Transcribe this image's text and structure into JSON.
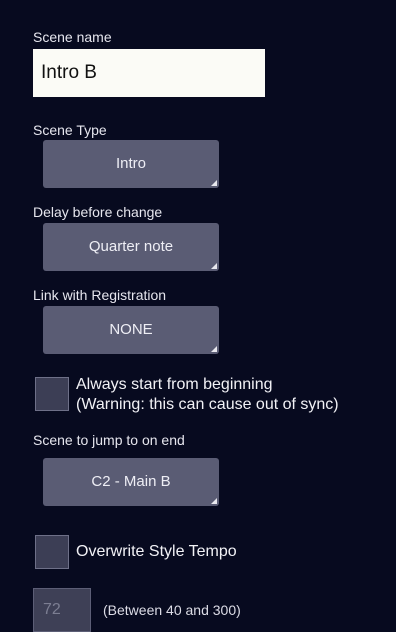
{
  "scene_name": {
    "label": "Scene name",
    "value": "Intro B"
  },
  "scene_type": {
    "label": "Scene Type",
    "value": "Intro"
  },
  "delay": {
    "label": "Delay before change",
    "value": "Quarter note"
  },
  "registration": {
    "label": "Link with Registration",
    "value": "NONE"
  },
  "always_start": {
    "checked": false,
    "line1": "Always start from beginning",
    "line2": "(Warning: this can cause out of sync)"
  },
  "jump_scene": {
    "label": "Scene to jump to on end",
    "value": "C2 - Main B"
  },
  "overwrite_tempo": {
    "checked": false,
    "label": "Overwrite Style Tempo"
  },
  "tempo": {
    "value": "72",
    "hint": "(Between 40 and 300)"
  },
  "colors": {
    "background": "#070a1f",
    "dropdown": "#5a5c74",
    "input": "#fbfbf6"
  }
}
